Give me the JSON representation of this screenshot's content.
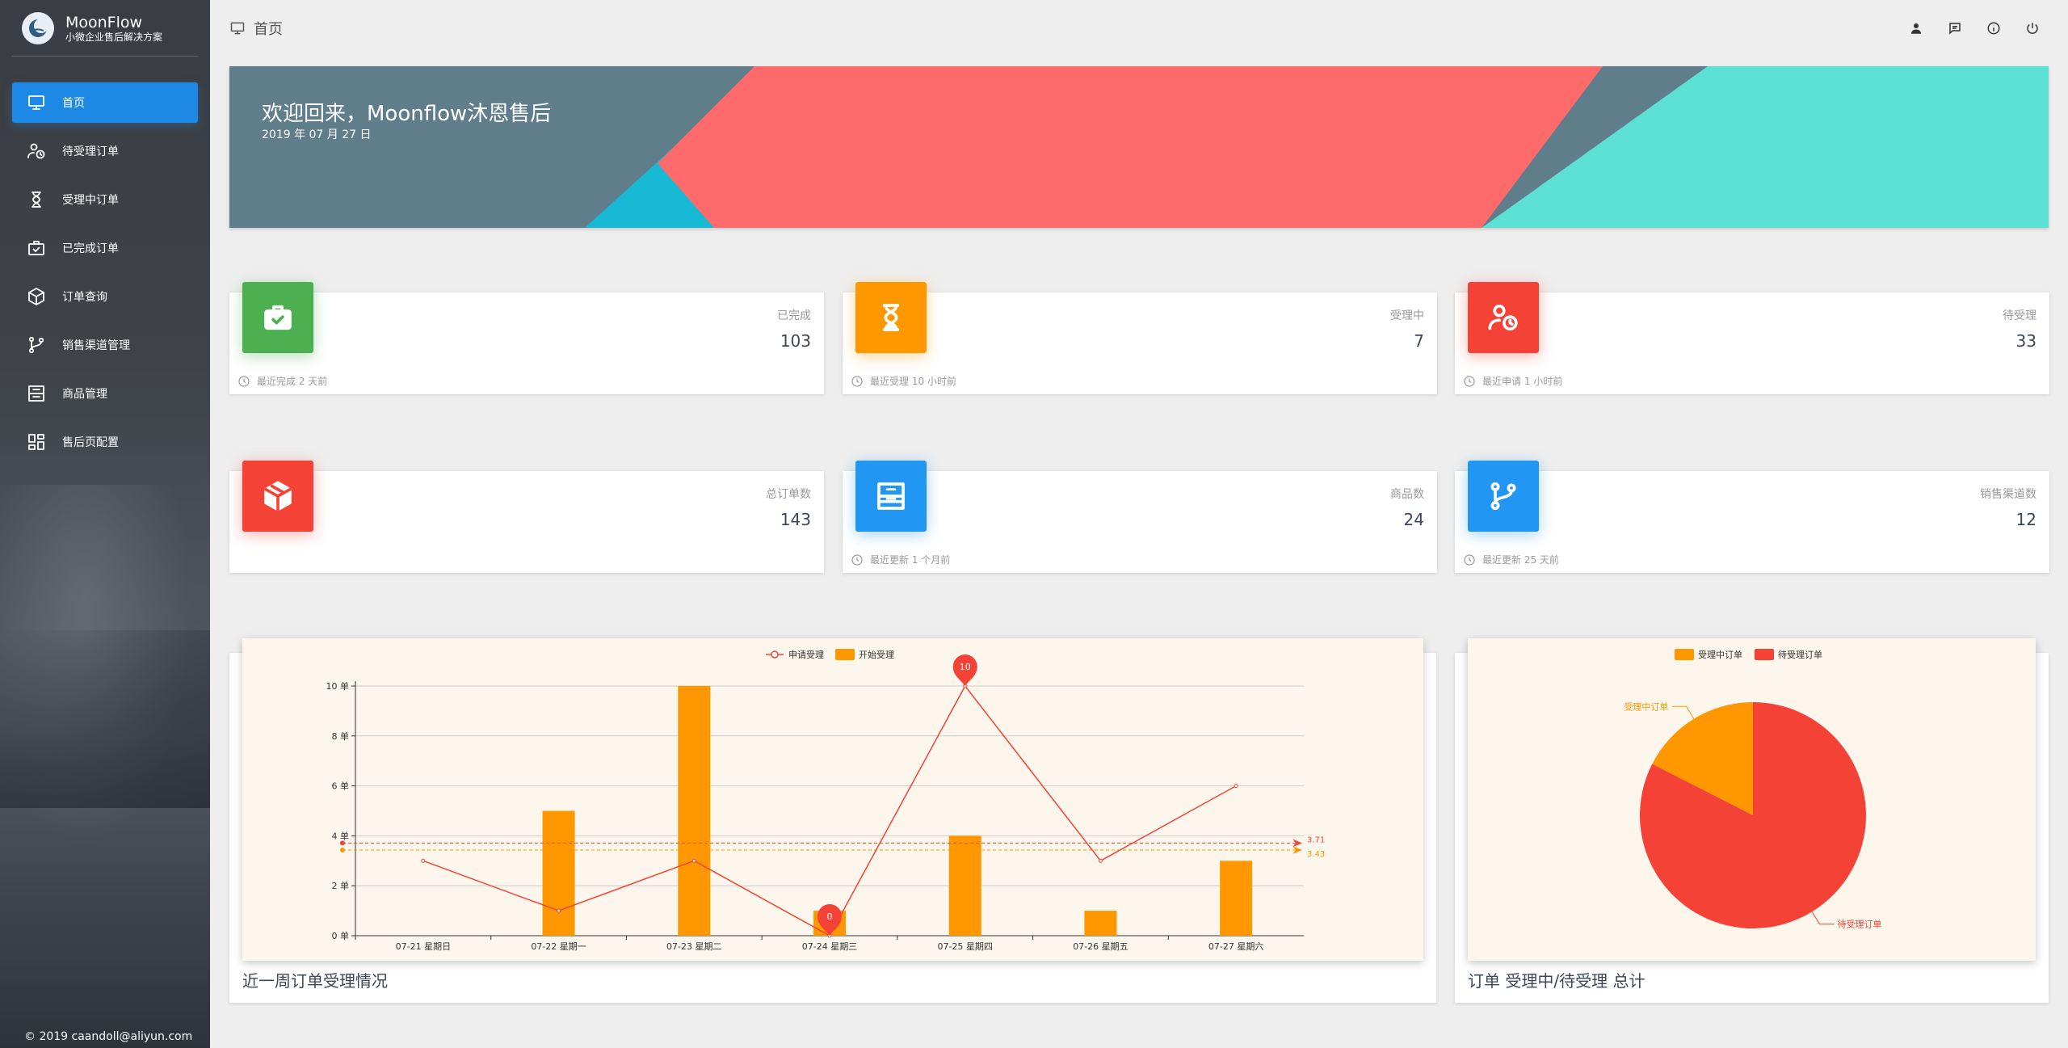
{
  "sidebar": {
    "logo_name": "MoonFlow",
    "logo_sub": "小微企业售后解决方案",
    "items": [
      {
        "label": "首页",
        "icon": "monitor-icon"
      },
      {
        "label": "待受理订单",
        "icon": "user-clock-icon"
      },
      {
        "label": "受理中订单",
        "icon": "hourglass-icon"
      },
      {
        "label": "已完成订单",
        "icon": "briefcase-check-icon"
      },
      {
        "label": "订单查询",
        "icon": "package-icon"
      },
      {
        "label": "销售渠道管理",
        "icon": "branch-icon"
      },
      {
        "label": "商品管理",
        "icon": "archive-icon"
      },
      {
        "label": "售后页配置",
        "icon": "dashboard-icon"
      }
    ],
    "copyright": "© 2019 caandoll@aliyun.com"
  },
  "header": {
    "crumb": "首页"
  },
  "banner": {
    "welcome": "欢迎回来，Moonflow沐恩售后",
    "date": "2019 年 07 月 27 日",
    "colors": {
      "slate": "#607d8b",
      "coral": "#ff6b6b",
      "teal": "#5ce1d4",
      "cyan": "#17b9d4"
    }
  },
  "stats": [
    {
      "label": "已完成",
      "value": "103",
      "foot": "最近完成 2 天前",
      "color": "#4caf50"
    },
    {
      "label": "受理中",
      "value": "7",
      "foot": "最近受理 10 小时前",
      "color": "#ff9800"
    },
    {
      "label": "待受理",
      "value": "33",
      "foot": "最近申请 1 小时前",
      "color": "#f44336"
    },
    {
      "label": "总订单数",
      "value": "143",
      "foot": "",
      "color": "#f44336"
    },
    {
      "label": "商品数",
      "value": "24",
      "foot": "最近更新 1 个月前",
      "color": "#2196f3"
    },
    {
      "label": "销售渠道数",
      "value": "12",
      "foot": "最近更新 25 天前",
      "color": "#2196f3"
    }
  ],
  "chart_data": [
    {
      "type": "bar",
      "title": "近一周订单受理情况",
      "categories": [
        "07-21 星期日",
        "07-22 星期一",
        "07-23 星期二",
        "07-24 星期三",
        "07-25 星期四",
        "07-26 星期五",
        "07-27 星期六"
      ],
      "series": [
        {
          "name": "申请受理",
          "kind": "line",
          "color": "#f44336",
          "values": [
            3,
            1,
            3,
            0,
            10,
            3,
            6
          ]
        },
        {
          "name": "开始受理",
          "kind": "bar",
          "color": "#ff9800",
          "values": [
            0,
            5,
            10,
            1,
            4,
            1,
            3
          ]
        }
      ],
      "yticks": [
        "0 单",
        "2 单",
        "4 单",
        "6 单",
        "8 单",
        "10 单"
      ],
      "ylim": [
        0,
        10
      ],
      "markers": [
        {
          "label": "10",
          "index": 4,
          "value": 10
        },
        {
          "label": "0",
          "index": 3,
          "value": 0
        }
      ],
      "averages": [
        {
          "label": "3.71",
          "value": 3.71,
          "color": "#f44336"
        },
        {
          "label": "3.43",
          "value": 3.43,
          "color": "#ff9800"
        }
      ],
      "legend": "top-center",
      "grid": true
    },
    {
      "type": "pie",
      "title": "订单 受理中/待受理 总计",
      "labels": [
        "受理中订单",
        "待受理订单"
      ],
      "values": [
        7,
        33
      ],
      "colors": [
        "#ff9800",
        "#f44336"
      ],
      "legend": "top-center"
    }
  ]
}
